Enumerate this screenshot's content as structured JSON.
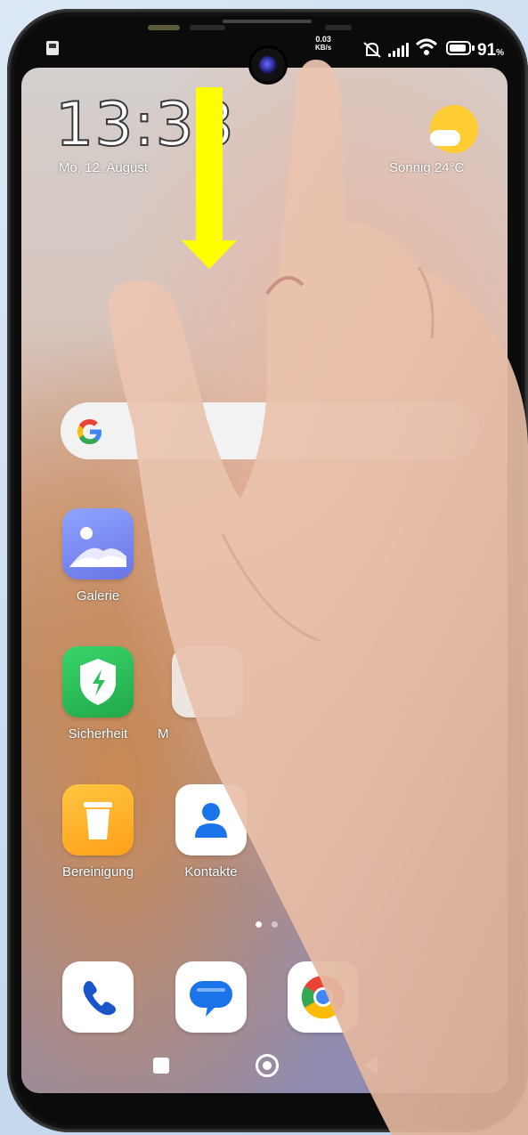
{
  "status_bar": {
    "speed_value": "0.03",
    "speed_unit": "KB/s",
    "battery_percent": "91",
    "battery_unit": "%"
  },
  "lock": {
    "time": "13:38",
    "date": "Mo, 12. August",
    "weather": "Sonnig  24°C"
  },
  "apps": [
    {
      "label": "Galerie",
      "icon": "gallery-icon"
    },
    {
      "label": "Sicherheit",
      "icon": "security-shield-icon"
    },
    {
      "label": "Bereinigung",
      "icon": "cleaner-icon"
    },
    {
      "label": "Kontakte",
      "icon": "contacts-icon"
    },
    {
      "label": "M",
      "icon": "partially-hidden-app-icon"
    }
  ],
  "dock": [
    {
      "icon": "phone-icon"
    },
    {
      "icon": "messages-icon"
    },
    {
      "icon": "chrome-icon"
    }
  ],
  "colors": {
    "arrow": "#ffff00",
    "gallery": "#7b8df5",
    "security": "#2ec05a",
    "cleaner": "#ffb020",
    "contacts": "#1a73e8"
  }
}
